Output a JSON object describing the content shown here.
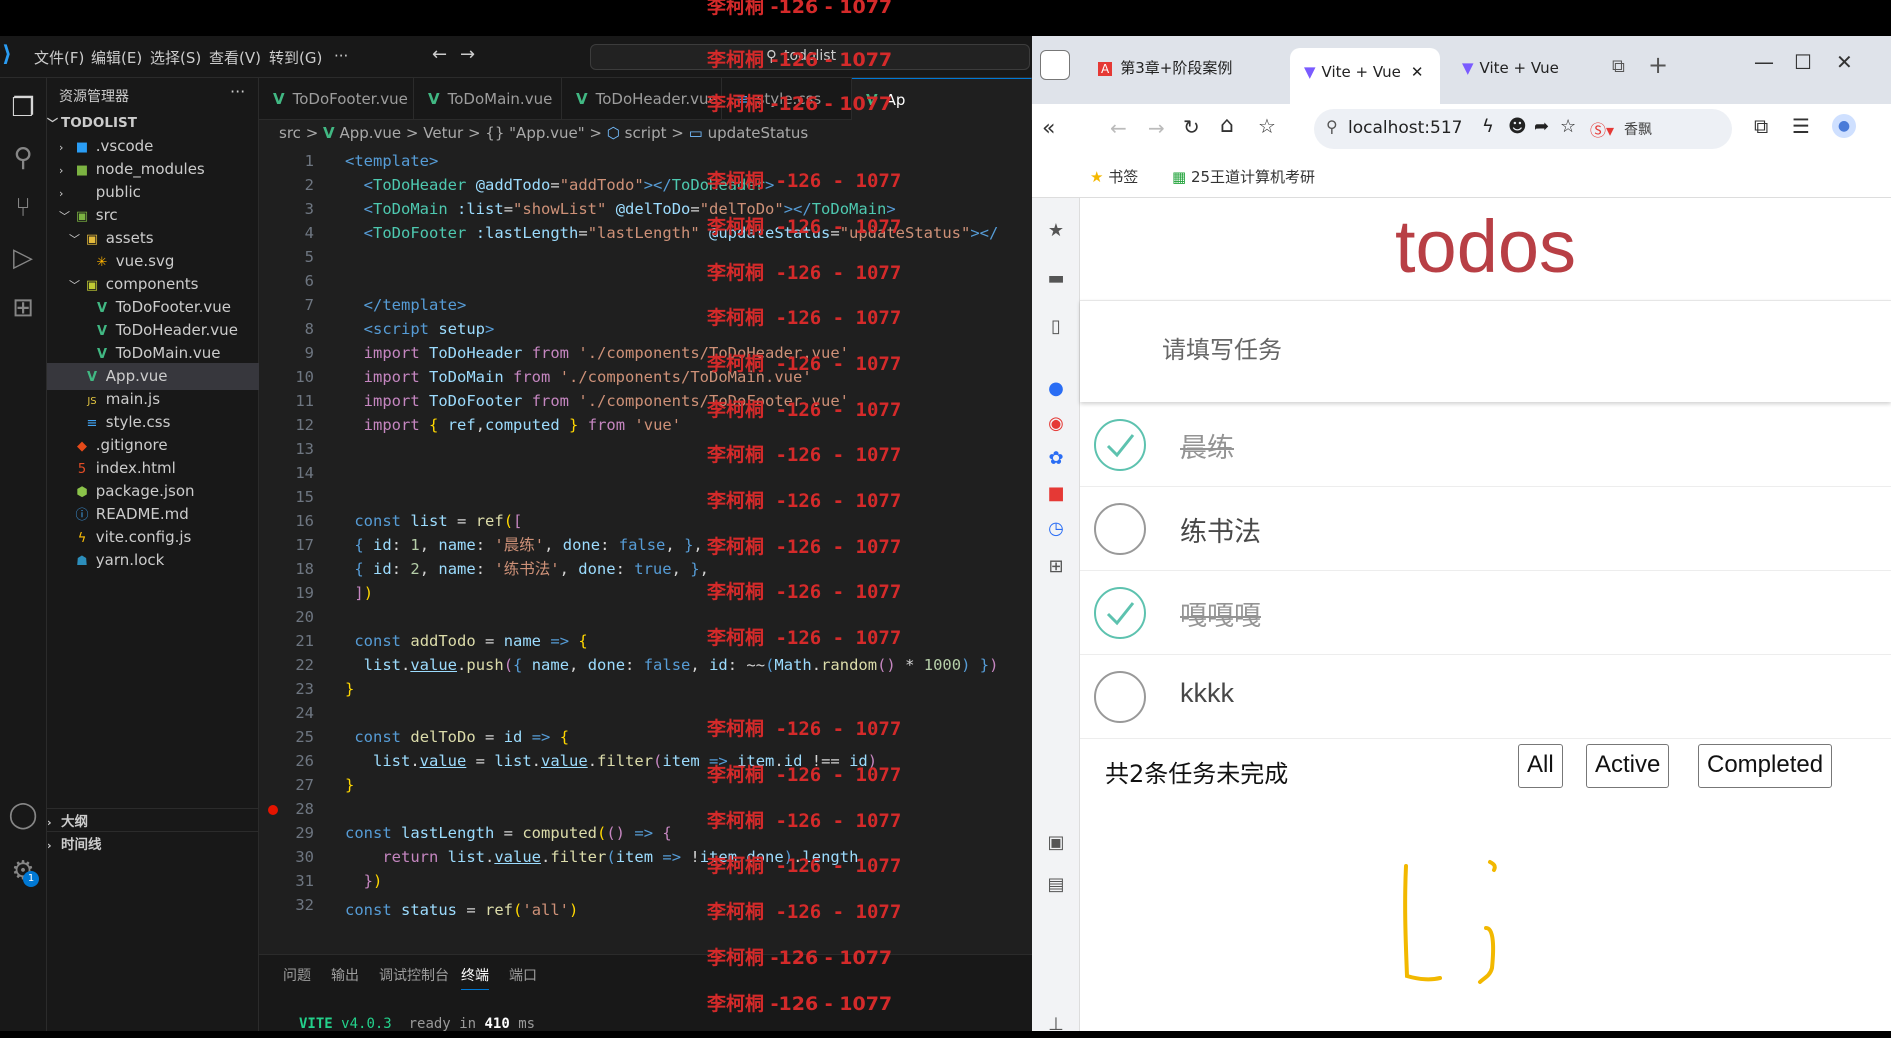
{
  "vscode": {
    "menu": [
      "文件(F)",
      "编辑(E)",
      "选择(S)",
      "查看(V)",
      "转到(G)",
      "···"
    ],
    "command_center": "todolist",
    "explorer_title": "资源管理器",
    "root": "TODOLIST",
    "tree": [
      {
        "label": ".vscode",
        "icon": "vscode-folder-icon"
      },
      {
        "label": "node_modules",
        "icon": "folder-icon"
      },
      {
        "label": "public",
        "icon": "folder-icon"
      },
      {
        "label": "src",
        "icon": "folder-icon"
      },
      {
        "label": "assets",
        "icon": "folder-icon"
      },
      {
        "label": "vue.svg",
        "icon": "svg-file-icon"
      },
      {
        "label": "components",
        "icon": "folder-icon"
      },
      {
        "label": "ToDoFooter.vue",
        "icon": "vue-file-icon"
      },
      {
        "label": "ToDoHeader.vue",
        "icon": "vue-file-icon"
      },
      {
        "label": "ToDoMain.vue",
        "icon": "vue-file-icon"
      },
      {
        "label": "App.vue",
        "icon": "vue-file-icon"
      },
      {
        "label": "main.js",
        "icon": "js-file-icon"
      },
      {
        "label": "style.css",
        "icon": "css-file-icon"
      },
      {
        "label": ".gitignore",
        "icon": "git-icon"
      },
      {
        "label": "index.html",
        "icon": "html-file-icon"
      },
      {
        "label": "package.json",
        "icon": "json-file-icon"
      },
      {
        "label": "README.md",
        "icon": "info-icon"
      },
      {
        "label": "vite.config.js",
        "icon": "vite-icon"
      },
      {
        "label": "yarn.lock",
        "icon": "yarn-icon"
      }
    ],
    "outline": "大纲",
    "timeline": "时间线",
    "tabs": [
      "ToDoFooter.vue",
      "ToDoMain.vue",
      "ToDoHeader.vue",
      "style.css",
      "Ap"
    ],
    "breadcrumb": [
      "src",
      ">",
      "App.vue",
      ">",
      "Vetur",
      ">",
      "{} \"App.vue\"",
      ">",
      "script",
      ">",
      "updateStatus"
    ],
    "panel_tabs": [
      "问题",
      "输出",
      "调试控制台",
      "终端",
      "端口"
    ],
    "terminal": {
      "vite": "VITE",
      "version": "v4.0.3",
      "ready": "ready",
      "in": "in",
      "ms_value": "410",
      "ms": "ms"
    },
    "watermark": "李柯桐 -126 - 1077",
    "notification_count": "1"
  },
  "code_lines": [
    "1",
    "2",
    "3",
    "4",
    "5",
    "6",
    "7",
    "8",
    "9",
    "10",
    "11",
    "12",
    "13",
    "14",
    "15",
    "16",
    "17",
    "18",
    "19",
    "20",
    "21",
    "22",
    "23",
    "24",
    "25",
    "26",
    "27",
    "28",
    "29",
    "30",
    "31",
    "32"
  ],
  "chrome": {
    "tabs": [
      "第3章+阶段案例",
      "Vite + Vue",
      "Vite + Vue"
    ],
    "address": "localhost:517",
    "sogou": "香飘",
    "bookmarks": [
      "书签",
      "25王道计算机考研"
    ]
  },
  "app": {
    "title": "todos",
    "placeholder": "请填写任务",
    "todos": [
      {
        "name": "晨练",
        "done": true
      },
      {
        "name": "练书法",
        "done": false
      },
      {
        "name": "嘎嘎嘎",
        "done": true
      },
      {
        "name": "kkkk",
        "done": false
      }
    ],
    "count_text": "共2条任务未完成",
    "filters": [
      "All",
      "Active",
      "Completed"
    ]
  },
  "colors": {
    "accent": "#b83f45",
    "check": "#5dc2af",
    "annotation": "#f2b800"
  }
}
